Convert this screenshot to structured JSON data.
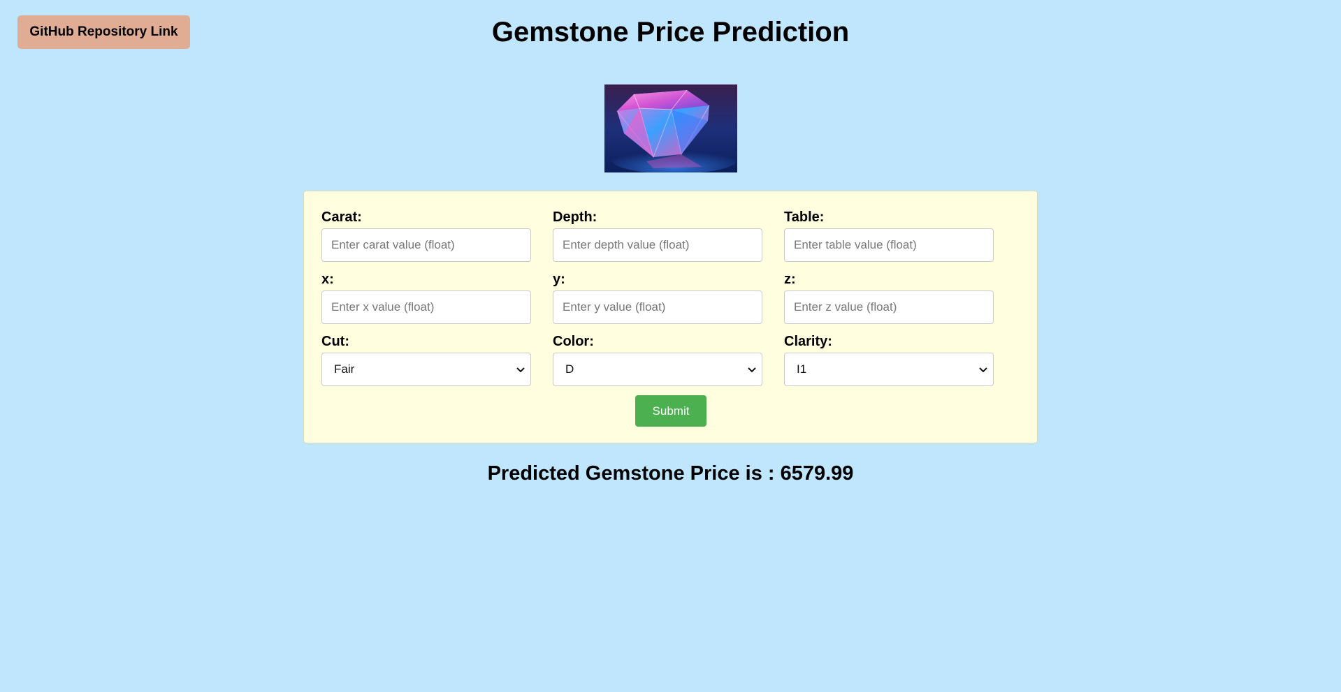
{
  "header": {
    "github_link_label": "GitHub Repository Link",
    "title": "Gemstone Price Prediction"
  },
  "image": {
    "icon": "pink-diamond-image"
  },
  "form": {
    "carat": {
      "label": "Carat:",
      "placeholder": "Enter carat value (float)",
      "value": ""
    },
    "depth": {
      "label": "Depth:",
      "placeholder": "Enter depth value (float)",
      "value": ""
    },
    "table": {
      "label": "Table:",
      "placeholder": "Enter table value (float)",
      "value": ""
    },
    "x": {
      "label": "x:",
      "placeholder": "Enter x value (float)",
      "value": ""
    },
    "y": {
      "label": "y:",
      "placeholder": "Enter y value (float)",
      "value": ""
    },
    "z": {
      "label": "z:",
      "placeholder": "Enter z value (float)",
      "value": ""
    },
    "cut": {
      "label": "Cut:",
      "selected": "Fair"
    },
    "color": {
      "label": "Color:",
      "selected": "D"
    },
    "clarity": {
      "label": "Clarity:",
      "selected": "I1"
    },
    "submit_label": "Submit"
  },
  "result": {
    "text": "Predicted Gemstone Price is : 6579.99"
  },
  "colors": {
    "background": "#bfe6fd",
    "form_background": "#ffffdf",
    "github_button": "#e0ac94",
    "submit_button": "#4caf50"
  }
}
